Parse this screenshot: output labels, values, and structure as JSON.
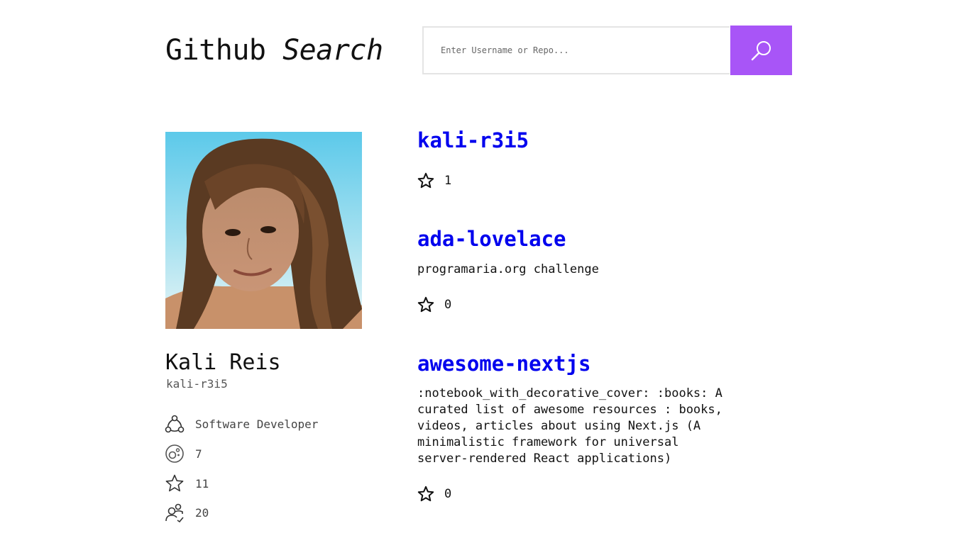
{
  "header": {
    "logo_main": "Github",
    "logo_italic": "Search",
    "search_placeholder": "Enter Username or Repo..."
  },
  "profile": {
    "name": "Kali Reis",
    "login": "kali-r3i5",
    "stats": [
      {
        "icon": "network-icon",
        "value": "Software Developer"
      },
      {
        "icon": "repo-icon",
        "value": "7"
      },
      {
        "icon": "star-icon",
        "value": "11"
      },
      {
        "icon": "followers-icon",
        "value": "20"
      }
    ]
  },
  "repos": [
    {
      "name": "kali-r3i5",
      "description": "",
      "stars": "1"
    },
    {
      "name": "ada-lovelace",
      "description": "programaria.org challenge",
      "stars": "0"
    },
    {
      "name": "awesome-nextjs",
      "description": ":notebook_with_decorative_cover: :books: A curated list of awesome resources : books, videos, articles about using Next.js (A minimalistic framework for universal server-rendered React applications)",
      "stars": "0"
    }
  ],
  "colors": {
    "accent": "#a855f7",
    "link": "#0000ee",
    "sky": "#8fd6ec"
  }
}
